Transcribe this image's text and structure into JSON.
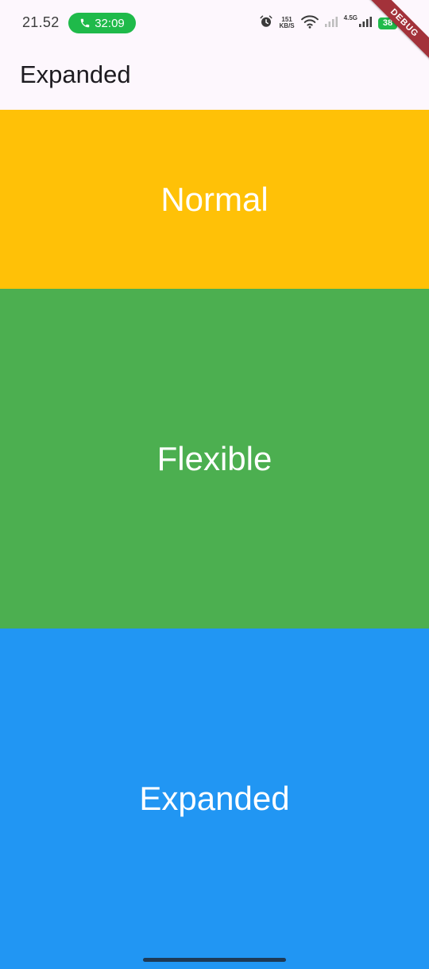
{
  "status_bar": {
    "time": "21.52",
    "call_duration": "32:09",
    "speed_value": "151",
    "speed_unit": "KB/S",
    "network_type": "4.5G",
    "battery_level": "38",
    "icons": [
      "phone-icon",
      "alarm-icon",
      "wifi-icon",
      "signal-icon",
      "battery-icon"
    ]
  },
  "debug_banner": "DEBUG",
  "app_bar": {
    "title": "Expanded"
  },
  "blocks": [
    {
      "label": "Normal",
      "color": "#ffc107"
    },
    {
      "label": "Flexible",
      "color": "#4caf50"
    },
    {
      "label": "Expanded",
      "color": "#2196f3"
    }
  ],
  "colors": {
    "call_pill": "#1fba4a",
    "debug_banner": "#a3323a",
    "app_bar_bg": "#fdf7fd"
  }
}
